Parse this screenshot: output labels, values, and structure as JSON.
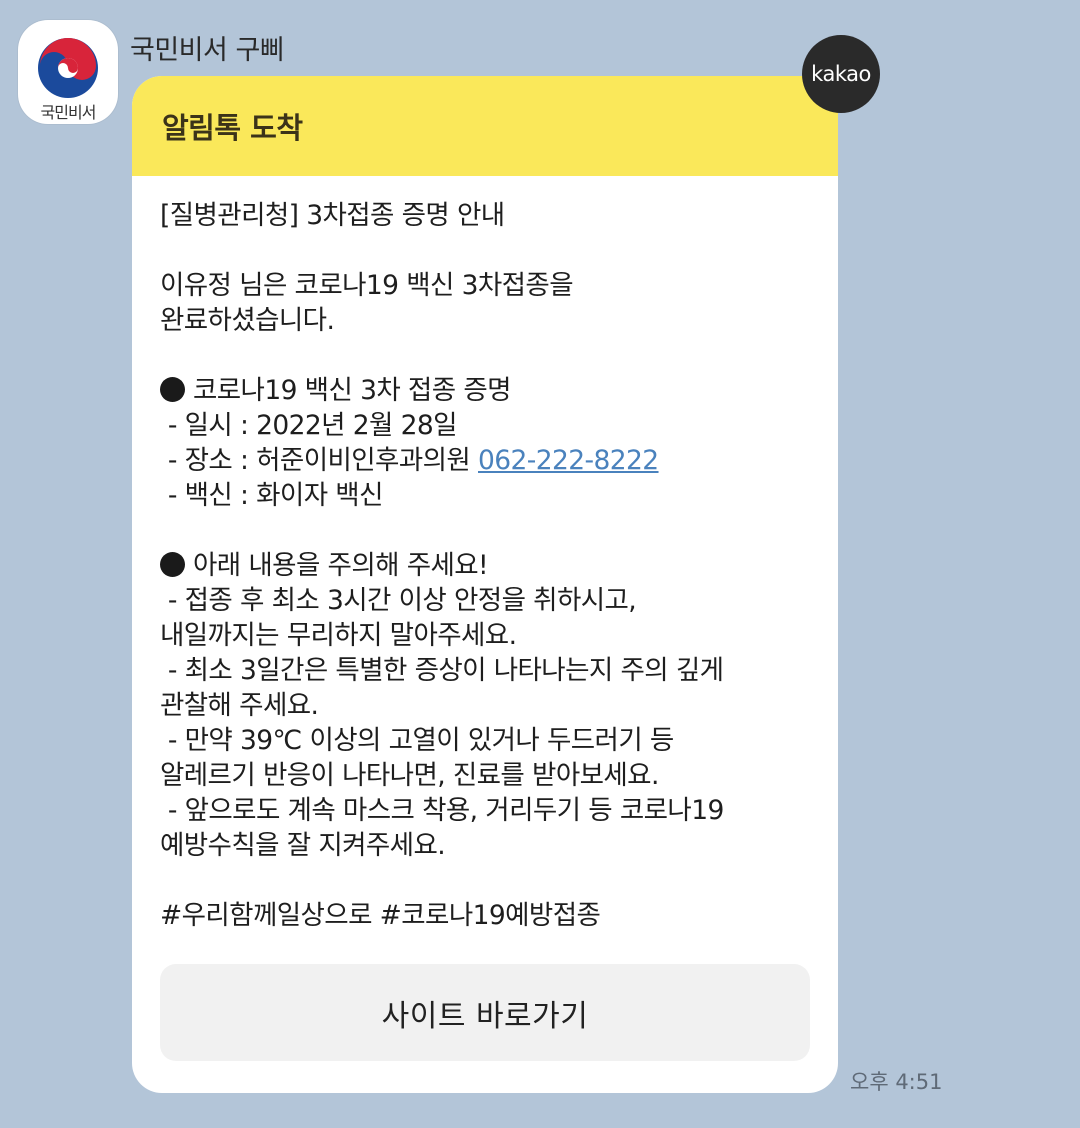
{
  "sender": {
    "name": "국민비서 구삐",
    "avatar_label": "국민비서"
  },
  "badge": {
    "label": "kakao"
  },
  "message": {
    "header": "알림톡 도착",
    "lines": {
      "l1": "[질병관리청] 3차접종 증명 안내",
      "l2": "이유정 님은 코로나19 백신 3차접종을",
      "l3": "완료하셨습니다.",
      "l4": "코로나19 백신 3차 접종 증명",
      "l5": " - 일시 : 2022년 2월 28일",
      "l6": " - 장소 : 허준이비인후과의원 ",
      "l6_phone": "062-222-8222",
      "l7": " - 백신 : 화이자 백신",
      "l8": "아래 내용을 주의해 주세요!",
      "l9": " - 접종 후 최소 3시간 이상 안정을 취하시고,",
      "l10": "내일까지는 무리하지 말아주세요.",
      "l11": " - 최소 3일간은 특별한 증상이 나타나는지 주의 깊게",
      "l12": "관찰해 주세요.",
      "l13": " - 만약 39℃ 이상의 고열이 있거나 두드러기 등",
      "l14": "알레르기 반응이 나타나면, 진료를 받아보세요.",
      "l15": " - 앞으로도 계속 마스크 착용, 거리두기 등 코로나19",
      "l16": "예방수칙을 잘 지켜주세요.",
      "l17": "#우리함께일상으로 #코로나19예방접종"
    },
    "button_label": "사이트 바로가기",
    "time": "오후 4:51"
  },
  "icons": {
    "avatar": "korea-emblem-icon",
    "bullet": "filled-circle-icon"
  },
  "colors": {
    "background": "#b3c5d8",
    "header": "#fae85a",
    "link": "#4a82bd",
    "badge": "#2a2a2a"
  }
}
